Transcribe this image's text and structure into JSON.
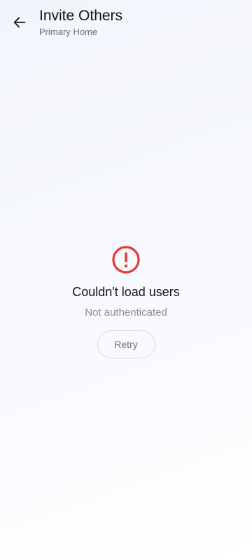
{
  "header": {
    "back_icon": "arrow-back-icon",
    "title": "Invite Others",
    "subtitle": "Primary Home"
  },
  "error": {
    "icon": "error-circle-icon",
    "icon_color": "#e53935",
    "title": "Couldn't load users",
    "message": "Not authenticated",
    "retry_label": "Retry"
  }
}
